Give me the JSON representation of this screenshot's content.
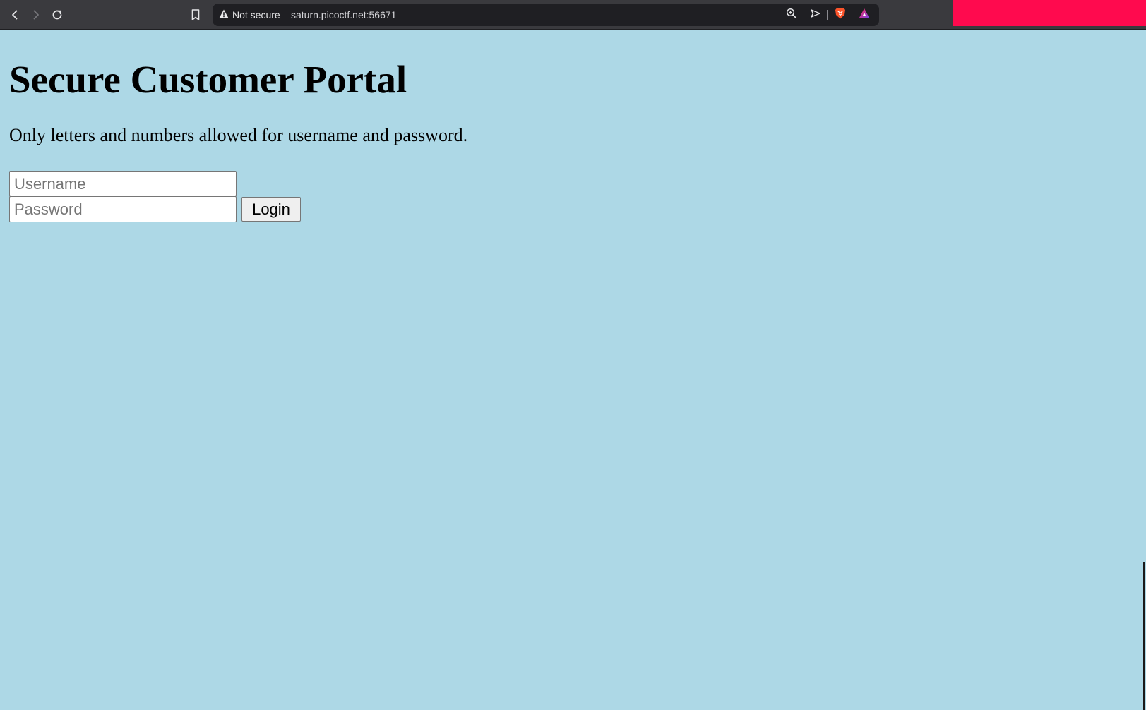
{
  "browser": {
    "security_label": "Not secure",
    "url": "saturn.picoctf.net:56671",
    "icons": [
      "back-icon",
      "forward-icon",
      "reload-icon",
      "bookmark-icon",
      "warning-icon",
      "zoom-icon",
      "send-icon",
      "brave-shield-icon",
      "brave-rewards-icon"
    ],
    "redaction_color": "#ff0a4e"
  },
  "page": {
    "title": "Secure Customer Portal",
    "description": "Only letters and numbers allowed for username and password.",
    "username_placeholder": "Username",
    "password_placeholder": "Password",
    "login_label": "Login",
    "background_color": "#add8e6"
  }
}
